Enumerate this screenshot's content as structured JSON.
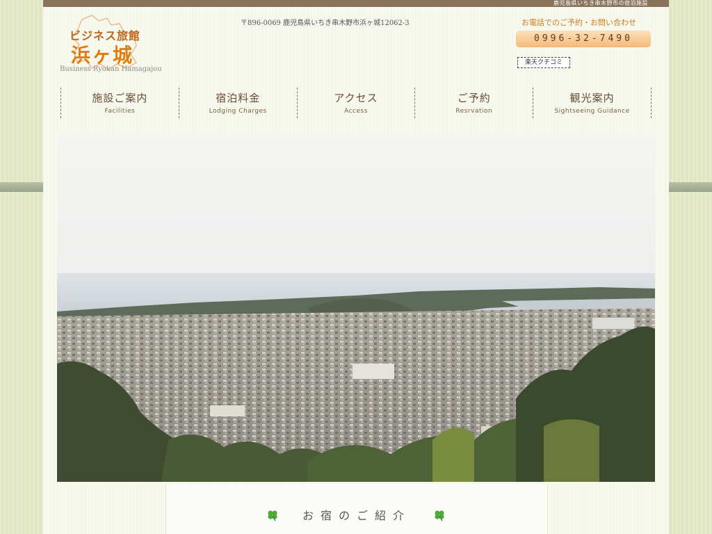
{
  "topbar": {
    "text": "鹿児島県いちき串木野市の宿泊施設"
  },
  "logo": {
    "line1": "ビジネス旅館",
    "line2": "浜ヶ城",
    "sub": "Business Ryokan Hamagajou"
  },
  "address": "〒896-0069 鹿児島県いちき串木野市浜ヶ城12062-3",
  "contact": {
    "label": "お電話でのご予約・お問い合わせ",
    "phone": "0996-32-7490",
    "rakuten": "楽天クチコミ"
  },
  "nav": [
    {
      "jp": "施設ご案内",
      "en": "Facilities"
    },
    {
      "jp": "宿泊料金",
      "en": "Lodging Charges"
    },
    {
      "jp": "アクセス",
      "en": "Access"
    },
    {
      "jp": "ご予約",
      "en": "Resrvation"
    },
    {
      "jp": "観光案内",
      "en": "Sightseeing Guidance"
    }
  ],
  "intro": {
    "title": "お宿のご紹介"
  },
  "colors": {
    "accent": "#e07e12",
    "nav_text": "#6b4b34",
    "topbar": "#8a735b"
  }
}
